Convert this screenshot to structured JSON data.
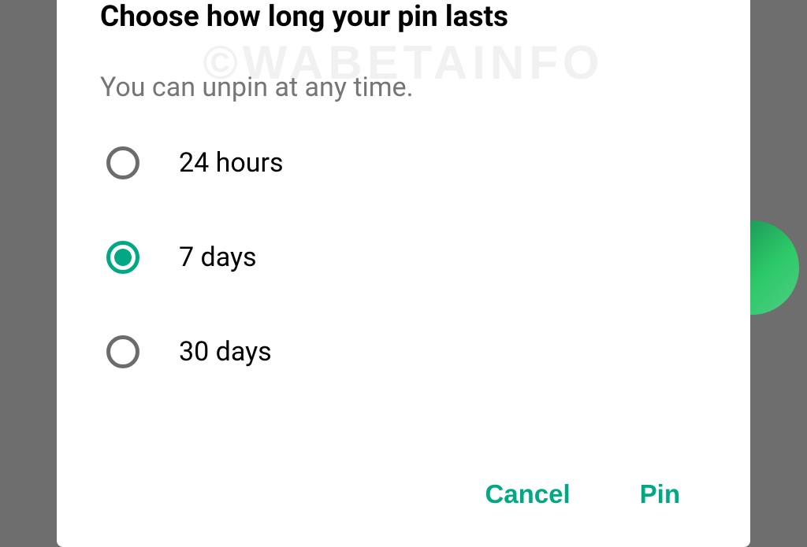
{
  "watermark": "©WABETAINFO",
  "dialog": {
    "title": "Choose how long your pin lasts",
    "subtitle": "You can unpin at any time.",
    "options": [
      {
        "label": "24 hours",
        "selected": false
      },
      {
        "label": "7 days",
        "selected": true
      },
      {
        "label": "30 days",
        "selected": false
      }
    ],
    "buttons": {
      "cancel": "Cancel",
      "confirm": "Pin"
    }
  }
}
